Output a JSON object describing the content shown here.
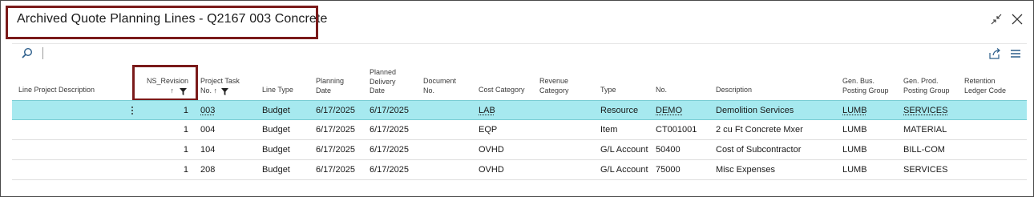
{
  "window": {
    "title": "Archived Quote Planning Lines - Q2167  003 Concrete"
  },
  "table": {
    "columns": [
      {
        "key": "line_project_description",
        "label": "Line Project Description"
      },
      {
        "key": "ns_revision",
        "label": "NS_Revision",
        "sort": "↑"
      },
      {
        "key": "project_task_no",
        "label": "Project Task No.",
        "sort": "↑",
        "line1": "Project Task",
        "line2": "No."
      },
      {
        "key": "line_type",
        "label": "Line Type"
      },
      {
        "key": "planning_date",
        "label": "Planning Date",
        "line1": "Planning",
        "line2": "Date"
      },
      {
        "key": "planned_delivery_date",
        "label": "Planned Delivery Date",
        "line1": "Planned",
        "line2": "Delivery",
        "line3": "Date"
      },
      {
        "key": "document_no",
        "label": "Document No.",
        "line1": "Document",
        "line2": "No."
      },
      {
        "key": "cost_category",
        "label": "Cost Category"
      },
      {
        "key": "revenue_category",
        "label": "Revenue Category",
        "line1": "Revenue",
        "line2": "Category"
      },
      {
        "key": "type",
        "label": "Type"
      },
      {
        "key": "no",
        "label": "No."
      },
      {
        "key": "description",
        "label": "Description"
      },
      {
        "key": "gen_bus_posting_group",
        "label": "Gen. Bus. Posting Group",
        "line1": "Gen. Bus.",
        "line2": "Posting Group"
      },
      {
        "key": "gen_prod_posting_group",
        "label": "Gen. Prod. Posting Group",
        "line1": "Gen. Prod.",
        "line2": "Posting Group"
      },
      {
        "key": "retention_ledger_code",
        "label": "Retention Ledger Code",
        "line1": "Retention",
        "line2": "Ledger Code"
      }
    ],
    "rows": [
      {
        "line_project_description": "",
        "ns_revision": "1",
        "project_task_no": "003",
        "line_type": "Budget",
        "planning_date": "6/17/2025",
        "planned_delivery_date": "6/17/2025",
        "document_no": "",
        "cost_category": "LAB",
        "revenue_category": "",
        "type": "Resource",
        "no": "DEMO",
        "description": "Demolition Services",
        "gen_bus_posting_group": "LUMB",
        "gen_prod_posting_group": "SERVICES",
        "retention_ledger_code": ""
      },
      {
        "line_project_description": "",
        "ns_revision": "1",
        "project_task_no": "004",
        "line_type": "Budget",
        "planning_date": "6/17/2025",
        "planned_delivery_date": "6/17/2025",
        "document_no": "",
        "cost_category": "EQP",
        "revenue_category": "",
        "type": "Item",
        "no": "CT001001",
        "description": "2 cu Ft Concrete Mxer",
        "gen_bus_posting_group": "LUMB",
        "gen_prod_posting_group": "MATERIAL",
        "retention_ledger_code": ""
      },
      {
        "line_project_description": "",
        "ns_revision": "1",
        "project_task_no": "104",
        "line_type": "Budget",
        "planning_date": "6/17/2025",
        "planned_delivery_date": "6/17/2025",
        "document_no": "",
        "cost_category": "OVHD",
        "revenue_category": "",
        "type": "G/L Account",
        "no": "50400",
        "description": "Cost of Subcontractor",
        "gen_bus_posting_group": "LUMB",
        "gen_prod_posting_group": "BILL-COM",
        "retention_ledger_code": ""
      },
      {
        "line_project_description": "",
        "ns_revision": "1",
        "project_task_no": "208",
        "line_type": "Budget",
        "planning_date": "6/17/2025",
        "planned_delivery_date": "6/17/2025",
        "document_no": "",
        "cost_category": "OVHD",
        "revenue_category": "",
        "type": "G/L Account",
        "no": "75000",
        "description": "Misc Expenses",
        "gen_bus_posting_group": "LUMB",
        "gen_prod_posting_group": "SERVICES",
        "retention_ledger_code": ""
      }
    ],
    "selected_row": 0
  },
  "colors": {
    "selected_row": "#a6e9ef",
    "highlight_border": "#7a1a1a"
  },
  "icons": {
    "expand": "collapse-arrows-icon",
    "close": "close-icon",
    "search": "search-icon",
    "share": "share-icon",
    "columns": "column-list-icon",
    "filter": "filter-funnel-icon"
  }
}
